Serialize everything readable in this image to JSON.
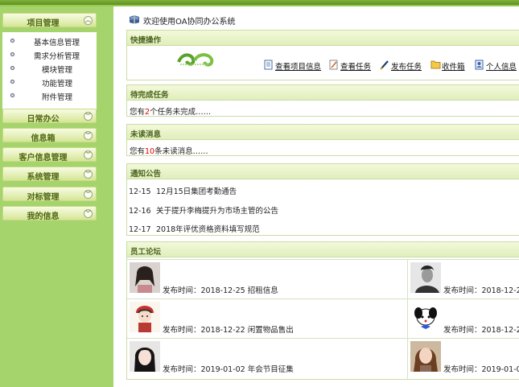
{
  "sidebar": {
    "project_mgmt": "项目管理",
    "sub_items": [
      "基本信息管理",
      "需求分析管理",
      "模块管理",
      "功能管理",
      "附件管理"
    ],
    "menus": [
      "日常办公",
      "信息箱",
      "客户信息管理",
      "系统管理",
      "对标管理",
      "我的信息"
    ]
  },
  "header": {
    "welcome": "欢迎使用OA协同办公系统"
  },
  "quick": {
    "title": "快捷操作",
    "links": [
      "查看项目信息",
      "查看任务",
      "发布任务",
      "收件箱",
      "个人信息"
    ]
  },
  "pending": {
    "title": "待完成任务",
    "prefix": "您有",
    "count": "2",
    "suffix": "个任务未完成……"
  },
  "unread": {
    "title": "未读消息",
    "prefix": "您有",
    "count": "10",
    "suffix": "条未读消息……"
  },
  "notices": {
    "title": "通知公告",
    "items": [
      {
        "date": "12-15",
        "text": "12月15日集团考勤通告"
      },
      {
        "date": "12-16",
        "text": "关于提升李梅提升为市场主管的公告"
      },
      {
        "date": "12-17",
        "text": "2018年评优资格资料填写规范"
      }
    ]
  },
  "forum": {
    "title": "员工论坛",
    "posts": [
      {
        "text": "发布时间：2018-12-25 招租信息"
      },
      {
        "text": "发布时间：2018-12-2"
      },
      {
        "text": "发布时间：2018-12-22 闲置物品售出"
      },
      {
        "text": "发布时间：2018-12-2"
      },
      {
        "text": "发布时间：2019-01-02 年会节目征集"
      },
      {
        "text": "发布时间：2019-01-0"
      }
    ]
  },
  "colors": {
    "sidebar_bg": "#a5d36c",
    "accent": "#7fb13a",
    "red": "#e00000"
  }
}
